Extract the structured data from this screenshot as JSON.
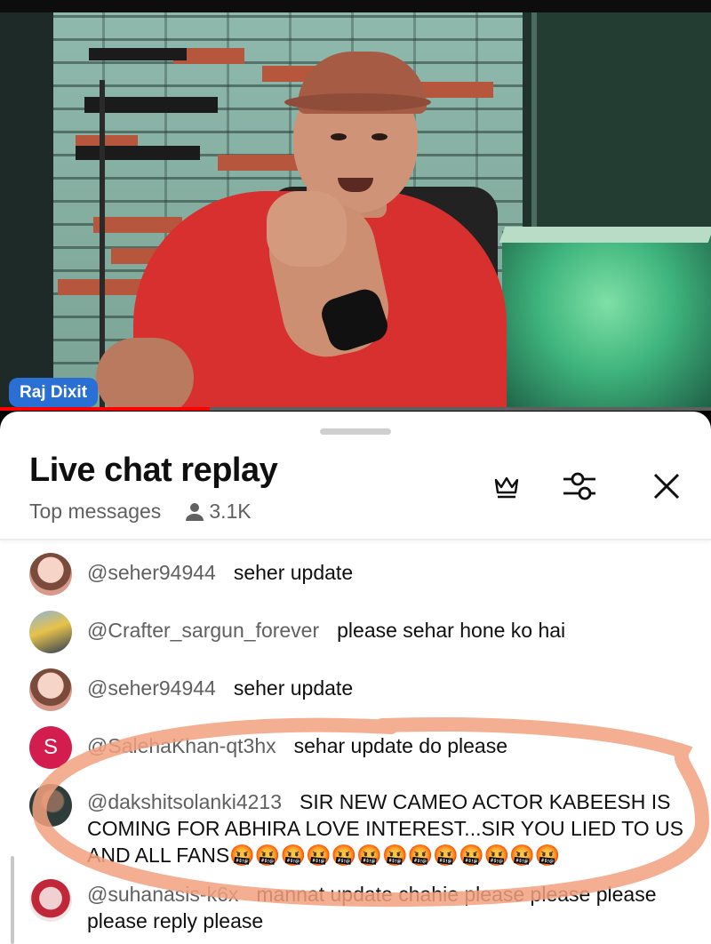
{
  "video": {
    "channel_label": "Raj Dixit",
    "progress": 0.295,
    "accent": "#ff0000"
  },
  "chat": {
    "title": "Live chat replay",
    "filter_label": "Top messages",
    "viewer_count": "3.1K",
    "icons": {
      "crown": "crown-icon",
      "settings": "sliders-icon",
      "close": "close-icon",
      "viewers": "person-icon"
    },
    "messages": [
      {
        "author": "@seher94944",
        "text": "seher update",
        "avatar": "doll"
      },
      {
        "author": "@Crafter_sargun_forever",
        "text": "please sehar hone ko hai",
        "avatar": "crafter"
      },
      {
        "author": "@seher94944",
        "text": "seher update",
        "avatar": "doll"
      },
      {
        "author": "@SalehaKhan-qt3hx",
        "text": "sehar update do please",
        "avatar": "letter",
        "initial": "S"
      },
      {
        "author": "@dakshitsolanki4213",
        "text": "SIR NEW CAMEO ACTOR KABEESH IS COMING FOR ABHIRA LOVE INTEREST...SIR YOU LIED TO US AND ALL FANS🤬🤬🤬🤬🤬🤬🤬🤬🤬🤬🤬🤬🤬",
        "avatar": "dark"
      },
      {
        "author": "@suhanasis-k6x",
        "text": "mannat update chahie please please please please reply please",
        "avatar": "suhana"
      }
    ]
  },
  "annotation_color": "#f2a07e"
}
